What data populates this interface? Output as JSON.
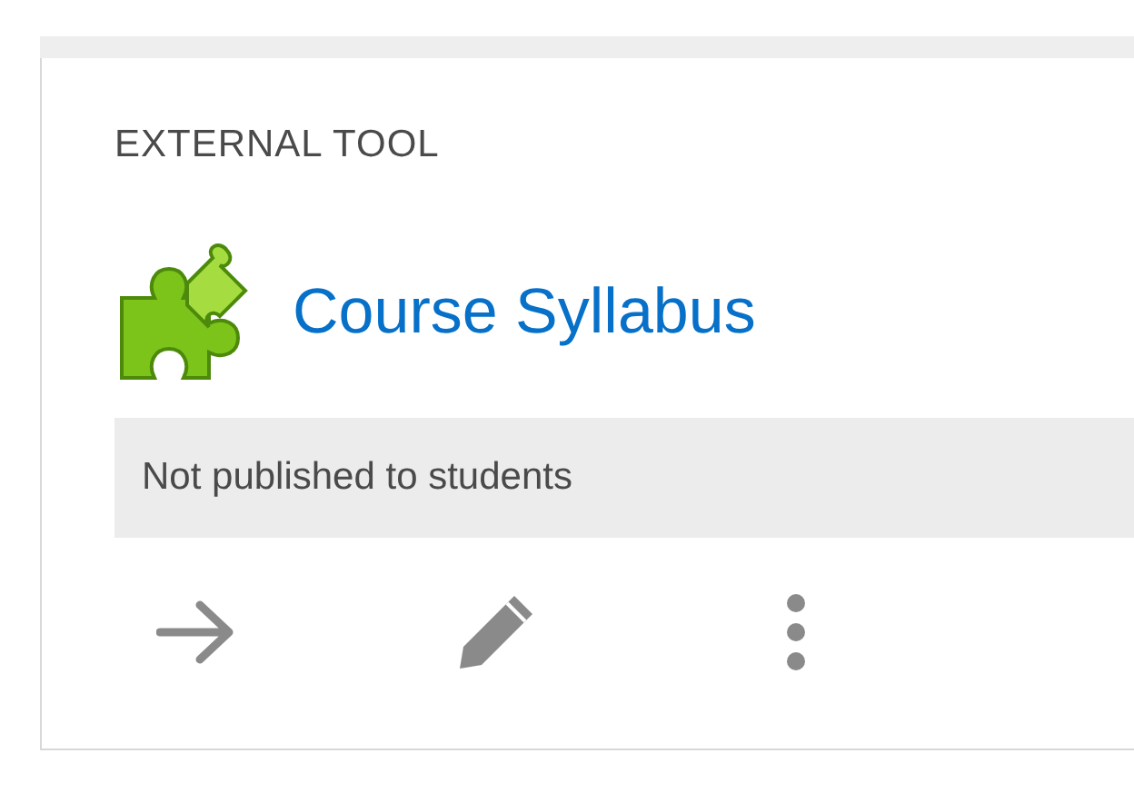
{
  "card": {
    "type_label": "EXTERNAL TOOL",
    "title": "Course Syllabus",
    "status": "Not published to students",
    "actions": [
      {
        "kind": "arrow"
      },
      {
        "kind": "edit"
      },
      {
        "kind": "more"
      }
    ]
  }
}
